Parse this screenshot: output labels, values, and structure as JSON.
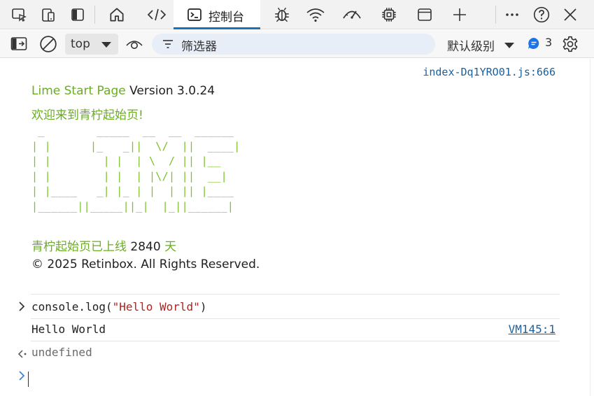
{
  "tabs": {
    "active_label": "控制台"
  },
  "toolbar": {
    "context": "top",
    "filter_placeholder": "筛选器",
    "levels_label": "默认级别",
    "message_count": "3"
  },
  "console": {
    "source_link": "index-Dq1YRO01.js:666",
    "greeting_app": "Lime Start Page",
    "greeting_version": " Version 3.0.24",
    "welcome": "欢迎来到青柠起始页!",
    "ascii_art": " _        _____  __  __  ______\n| |      |_   _||  \\/  ||  ____|\n| |        | |  | \\  / || |__\n| |        | |  | |\\/| ||  __|\n| |____   _| |_ | |  | || |____\n|______||_____||_|  |_||______|",
    "online_prefix": "青柠起始页已上线 ",
    "online_days": "2840",
    "online_suffix": " 天",
    "copyright": "© 2025 Retinbox. All Rights Reserved.",
    "input_code": "console.log(",
    "input_string": "\"Hello World\"",
    "input_close": ")",
    "output_text": "Hello World",
    "output_source": "VM145:1",
    "return_value": "undefined"
  },
  "colors": {
    "accent": "#1a73b8",
    "lime_green": "#6aae1f",
    "string_red": "#b1231e",
    "link_blue": "#1a5f9e"
  }
}
